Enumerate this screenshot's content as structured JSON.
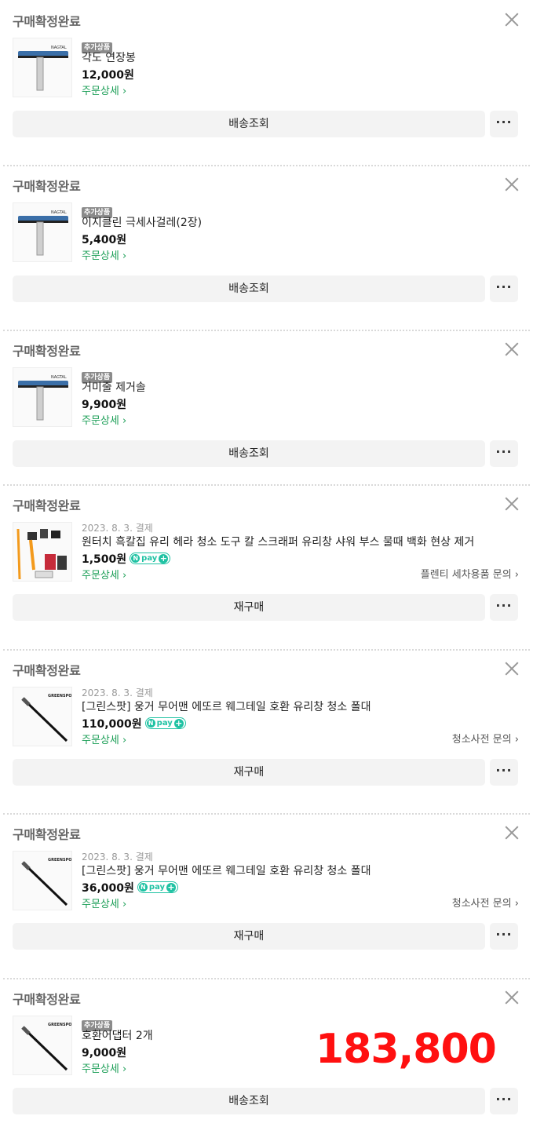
{
  "cards": [
    {
      "status": "구매확정완료",
      "badge": "추가상품",
      "name": "각도 연장봉",
      "price": "12,000원",
      "detail": "주문상세 ›",
      "button": "배송조회",
      "more": "···",
      "thumb": "squeegee"
    },
    {
      "status": "구매확정완료",
      "badge": "추가상품",
      "name": "이지클린 극세사걸레(2장)",
      "price": "5,400원",
      "detail": "주문상세 ›",
      "button": "배송조회",
      "more": "···",
      "thumb": "squeegee"
    },
    {
      "status": "구매확정완료",
      "badge": "추가상품",
      "name": "거미줄 제거솔",
      "price": "9,900원",
      "detail": "주문상세 ›",
      "button": "배송조회",
      "more": "···",
      "thumb": "squeegee"
    },
    {
      "status": "구매확정완료",
      "date": "2023. 8. 3. 결제",
      "name": "원터치 흑칼집 유리 헤라 청소 도구 칼 스크래퍼 유리창 샤워 부스 물때 백화 현상 제거",
      "price": "1,500원",
      "npay": "pay",
      "detail": "주문상세 ›",
      "inquiry": "플렌티 세차용품 문의 ›",
      "button": "재구매",
      "more": "···",
      "thumb": "scrapers"
    },
    {
      "status": "구매확정완료",
      "date": "2023. 8. 3. 결제",
      "name": "[그린스팟] 웅거 무어맨 에또르 웨그테일 호환 유리창 청소 폴대",
      "price": "110,000원",
      "npay": "pay",
      "detail": "주문상세 ›",
      "inquiry": "청소사전 문의 ›",
      "button": "재구매",
      "more": "···",
      "thumb": "pole"
    },
    {
      "status": "구매확정완료",
      "date": "2023. 8. 3. 결제",
      "name": "[그린스팟] 웅거 무어맨 에또르 웨그테일 호환 유리창 청소 폴대",
      "price": "36,000원",
      "npay": "pay",
      "detail": "주문상세 ›",
      "inquiry": "청소사전 문의 ›",
      "button": "재구매",
      "more": "···",
      "thumb": "pole"
    },
    {
      "status": "구매확정완료",
      "badge": "추가상품",
      "name": "호환어댑터 2개",
      "price": "9,000원",
      "detail": "주문상세 ›",
      "button": "배송조회",
      "more": "···",
      "thumb": "pole"
    }
  ],
  "overlay_total": "183,800",
  "colors": {
    "accent_green": "#1b9e56",
    "npay": "#1fc2a3",
    "overlay_red": "#ff1010"
  }
}
